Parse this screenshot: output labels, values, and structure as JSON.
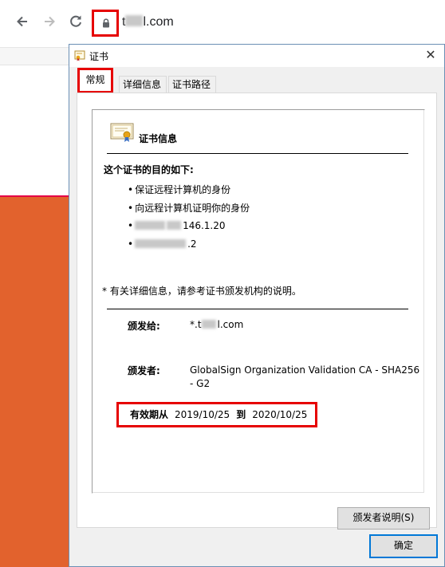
{
  "browser": {
    "url_prefix": "t",
    "url_suffix": "l.com",
    "back_icon": "arrow-left-icon",
    "forward_icon": "arrow-right-icon",
    "reload_icon": "reload-icon",
    "lock_icon": "lock-icon",
    "highlight_color": "#e60000"
  },
  "dialog": {
    "title": "证书",
    "close_icon": "close-icon",
    "tabs": [
      {
        "label": "常规",
        "active": true
      },
      {
        "label": "详细信息",
        "active": false
      },
      {
        "label": "证书路径",
        "active": false
      }
    ],
    "cert_info_heading": "证书信息",
    "purpose_heading": "这个证书的目的如下:",
    "purposes": [
      "保证远程计算机的身份",
      "向远程计算机证明你的身份",
      "146.1.20",
      ".2"
    ],
    "note": "* 有关详细信息，请参考证书颁发机构的说明。",
    "issued_to_label": "颁发给:",
    "issued_to_prefix": "*.t",
    "issued_to_suffix": "l.com",
    "issued_by_label": "颁发者:",
    "issued_by_value": "GlobalSign Organization Validation CA - SHA256 - G2",
    "validity_from_label": "有效期从",
    "validity_from": "2019/10/25",
    "validity_to_label": "到",
    "validity_to": "2020/10/25",
    "issuer_statement_button": "颁发者说明(S)",
    "ok_button": "确定"
  },
  "colors": {
    "accent_red": "#e60000",
    "page_orange": "#e2622d",
    "ok_button_border": "#0078d7"
  }
}
